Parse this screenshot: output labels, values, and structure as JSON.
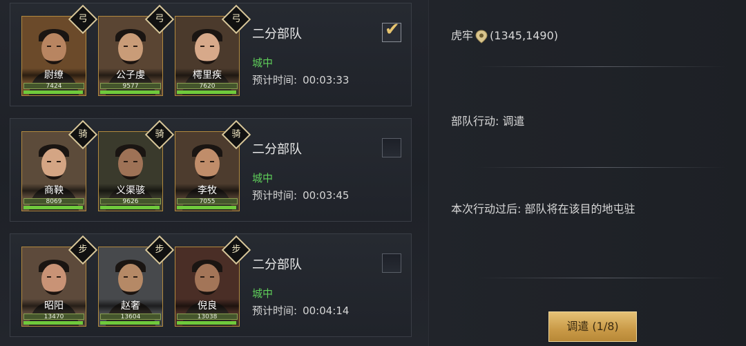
{
  "squads": [
    {
      "title": "二分部队",
      "location": "城中",
      "eta_label": "预计时间:",
      "eta": "00:03:33",
      "checked": true,
      "heroes": [
        {
          "name": "尉缭",
          "power": "7424",
          "troop_fill": 0.98,
          "badge": "弓",
          "skin": "#b88561",
          "bg": "#6b4a2a"
        },
        {
          "name": "公子虔",
          "power": "9577",
          "troop_fill": 0.98,
          "badge": "弓",
          "skin": "#c99c78",
          "bg": "#5a4533"
        },
        {
          "name": "樗里疾",
          "power": "7620",
          "troop_fill": 0.98,
          "badge": "弓",
          "skin": "#d7a98a",
          "bg": "#4b3a2c"
        }
      ]
    },
    {
      "title": "二分部队",
      "location": "城中",
      "eta_label": "预计时间:",
      "eta": "00:03:45",
      "checked": false,
      "heroes": [
        {
          "name": "商鞅",
          "power": "8069",
          "troop_fill": 0.98,
          "badge": "骑",
          "skin": "#d4a584",
          "bg": "#5c4b3a"
        },
        {
          "name": "义渠骇",
          "power": "9626",
          "troop_fill": 0.98,
          "badge": "骑",
          "skin": "#9e7256",
          "bg": "#3a3a2c"
        },
        {
          "name": "李牧",
          "power": "7055",
          "troop_fill": 0.98,
          "badge": "骑",
          "skin": "#c08d6a",
          "bg": "#4d3c2e"
        }
      ]
    },
    {
      "title": "二分部队",
      "location": "城中",
      "eta_label": "预计时间:",
      "eta": "00:04:14",
      "checked": false,
      "heroes": [
        {
          "name": "昭阳",
          "power": "13470",
          "troop_fill": 0.98,
          "badge": "步",
          "skin": "#c99376",
          "bg": "#5d4a3b"
        },
        {
          "name": "赵奢",
          "power": "13604",
          "troop_fill": 0.98,
          "badge": "步",
          "skin": "#b58966",
          "bg": "#47494c"
        },
        {
          "name": "倪良",
          "power": "13038",
          "troop_fill": 0.98,
          "badge": "步",
          "skin": "#a37558",
          "bg": "#4a2e26"
        }
      ]
    }
  ],
  "target": {
    "name": "虎牢",
    "coords": "(1345,1490)"
  },
  "action": "部队行动: 调遣",
  "after_action": "本次行动过后: 部队将在该目的地屯驻",
  "deploy_button": "调遣 (1/8)",
  "colors": {
    "location_green": "#5fcf5a",
    "gold_accent": "#e7c46f",
    "button_gold": "#c99a47"
  }
}
